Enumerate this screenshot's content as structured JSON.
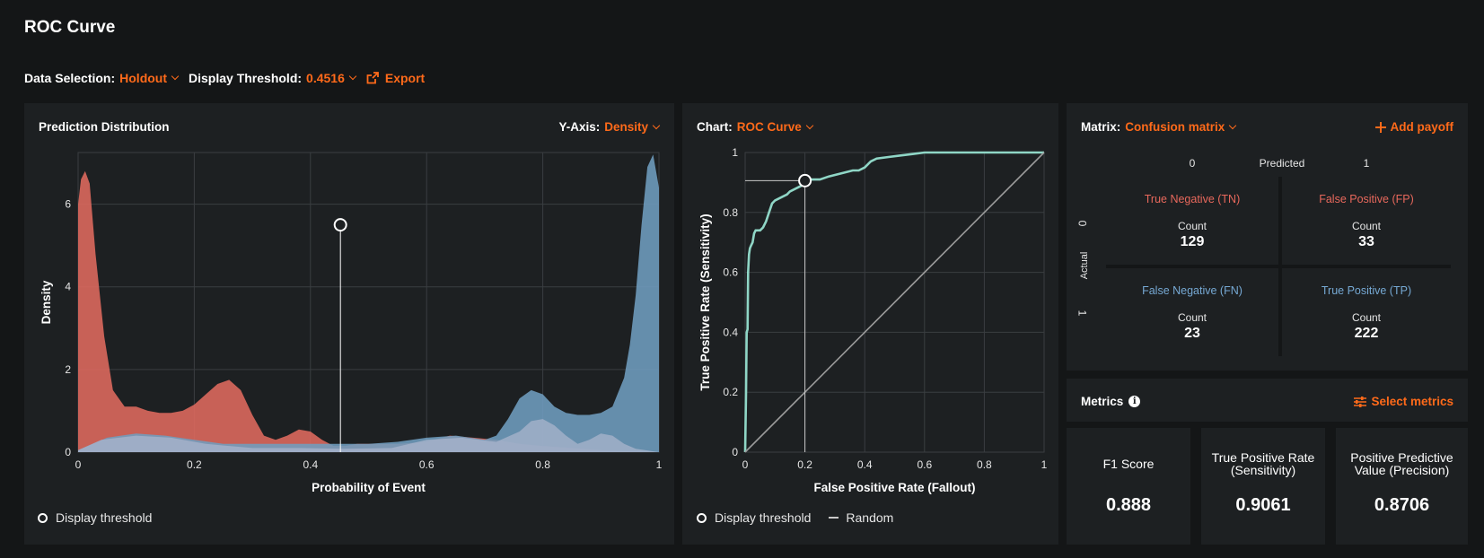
{
  "page_title": "ROC Curve",
  "toolbar": {
    "data_selection_label": "Data Selection:",
    "data_selection_value": "Holdout",
    "threshold_label": "Display Threshold:",
    "threshold_value": "0.4516",
    "export_label": "Export"
  },
  "distribution_panel": {
    "title": "Prediction Distribution",
    "yaxis_label": "Y-Axis:",
    "yaxis_value": "Density",
    "legend_threshold": "Display threshold"
  },
  "roc_panel": {
    "chart_label": "Chart:",
    "chart_value": "ROC Curve",
    "legend_threshold": "Display threshold",
    "legend_random": "Random"
  },
  "matrix_panel": {
    "matrix_label": "Matrix:",
    "matrix_value": "Confusion matrix",
    "add_payoff_label": "Add payoff",
    "predicted_label": "Predicted",
    "actual_label": "Actual",
    "col_0": "0",
    "col_1": "1",
    "row_0": "0",
    "row_1": "1",
    "count_label": "Count",
    "cells": {
      "tn": {
        "title": "True Negative (TN)",
        "count": "129"
      },
      "fp": {
        "title": "False Positive (FP)",
        "count": "33"
      },
      "fn": {
        "title": "False Negative (FN)",
        "count": "23"
      },
      "tp": {
        "title": "True Positive (TP)",
        "count": "222"
      }
    }
  },
  "metrics_panel": {
    "title": "Metrics",
    "select_label": "Select metrics",
    "metrics": [
      {
        "name": "F1 Score",
        "value": "0.888"
      },
      {
        "name": "True Positive Rate (Sensitivity)",
        "value": "0.9061"
      },
      {
        "name": "Positive Predictive Value (Precision)",
        "value": "0.8706"
      }
    ]
  },
  "colors": {
    "accent": "#ff6a1a",
    "negative_class": "#e06a5e",
    "positive_class": "#6f9dbf",
    "roc_line": "#8fd6c6",
    "panel_bg": "#1d2022",
    "page_bg": "#141617"
  },
  "chart_data": [
    {
      "type": "area",
      "xlabel": "Probability of Event",
      "ylabel": "Density",
      "xlim": [
        0,
        1
      ],
      "ylim": [
        0,
        7.25
      ],
      "xticks": [
        "0",
        "0.2",
        "0.4",
        "0.6",
        "0.8",
        "1"
      ],
      "yticks": [
        "0",
        "2",
        "4",
        "6"
      ],
      "threshold": {
        "x": 0.4516,
        "y": 5.5
      },
      "series": [
        {
          "color": "#e06a5e",
          "x": [
            0,
            0.005,
            0.012,
            0.02,
            0.03,
            0.045,
            0.06,
            0.08,
            0.1,
            0.12,
            0.14,
            0.16,
            0.18,
            0.2,
            0.22,
            0.24,
            0.26,
            0.28,
            0.3,
            0.32,
            0.34,
            0.36,
            0.38,
            0.4,
            0.42,
            0.44,
            0.46,
            0.48,
            0.5,
            0.55,
            0.6,
            0.64,
            0.68,
            0.72,
            0.76,
            0.8,
            0.85,
            0.9,
            0.95,
            1.0
          ],
          "y": [
            6.0,
            6.6,
            6.8,
            6.5,
            4.8,
            2.8,
            1.5,
            1.1,
            1.1,
            1.0,
            0.95,
            0.95,
            1.0,
            1.15,
            1.4,
            1.65,
            1.75,
            1.5,
            0.9,
            0.4,
            0.3,
            0.4,
            0.55,
            0.5,
            0.3,
            0.15,
            0.15,
            0.2,
            0.2,
            0.2,
            0.25,
            0.4,
            0.35,
            0.3,
            0.2,
            0.15,
            0.1,
            0.05,
            0.02,
            0
          ]
        },
        {
          "color": "#6f9dbf",
          "x": [
            0,
            0.05,
            0.1,
            0.15,
            0.2,
            0.25,
            0.3,
            0.35,
            0.4,
            0.45,
            0.5,
            0.55,
            0.6,
            0.65,
            0.7,
            0.72,
            0.74,
            0.76,
            0.78,
            0.8,
            0.82,
            0.84,
            0.86,
            0.88,
            0.9,
            0.92,
            0.94,
            0.95,
            0.96,
            0.97,
            0.98,
            0.99,
            1.0
          ],
          "y": [
            0.05,
            0.35,
            0.45,
            0.4,
            0.3,
            0.2,
            0.2,
            0.2,
            0.2,
            0.2,
            0.2,
            0.25,
            0.35,
            0.4,
            0.3,
            0.4,
            0.8,
            1.3,
            1.5,
            1.4,
            1.1,
            0.95,
            0.9,
            0.9,
            0.95,
            1.1,
            1.8,
            2.6,
            3.8,
            5.5,
            6.9,
            7.2,
            6.4
          ]
        },
        {
          "color": "#aab4cc",
          "x": [
            0,
            0.04,
            0.1,
            0.16,
            0.22,
            0.3,
            0.38,
            0.46,
            0.54,
            0.6,
            0.66,
            0.72,
            0.76,
            0.78,
            0.8,
            0.82,
            0.84,
            0.86,
            0.88,
            0.9,
            0.92,
            0.94,
            0.96,
            1.0
          ],
          "y": [
            0.05,
            0.3,
            0.4,
            0.35,
            0.2,
            0.1,
            0.1,
            0.08,
            0.1,
            0.3,
            0.35,
            0.25,
            0.5,
            0.75,
            0.8,
            0.65,
            0.4,
            0.2,
            0.3,
            0.45,
            0.4,
            0.2,
            0.08,
            0
          ]
        }
      ]
    },
    {
      "type": "line",
      "xlabel": "False Positive Rate (Fallout)",
      "ylabel": "True Positive Rate (Sensitivity)",
      "xlim": [
        0,
        1
      ],
      "ylim": [
        0,
        1
      ],
      "xticks": [
        "0",
        "0.2",
        "0.4",
        "0.6",
        "0.8",
        "1"
      ],
      "yticks": [
        "0",
        "0.2",
        "0.4",
        "0.6",
        "0.8",
        "1"
      ],
      "threshold": {
        "x": 0.2,
        "y": 0.9061
      },
      "series": [
        {
          "name": "ROC",
          "color": "#8fd6c6",
          "x": [
            0,
            0.003,
            0.005,
            0.008,
            0.01,
            0.013,
            0.016,
            0.02,
            0.025,
            0.03,
            0.035,
            0.05,
            0.06,
            0.07,
            0.08,
            0.09,
            0.1,
            0.12,
            0.14,
            0.15,
            0.17,
            0.19,
            0.2,
            0.22,
            0.25,
            0.28,
            0.32,
            0.36,
            0.38,
            0.4,
            0.42,
            0.44,
            0.48,
            0.52,
            0.56,
            0.6,
            0.62,
            1.0
          ],
          "y": [
            0,
            0.2,
            0.4,
            0.41,
            0.6,
            0.66,
            0.68,
            0.69,
            0.7,
            0.73,
            0.74,
            0.74,
            0.75,
            0.77,
            0.8,
            0.83,
            0.84,
            0.85,
            0.86,
            0.87,
            0.88,
            0.89,
            0.9,
            0.91,
            0.91,
            0.92,
            0.93,
            0.94,
            0.94,
            0.95,
            0.97,
            0.98,
            0.985,
            0.99,
            0.995,
            1.0,
            1.0,
            1.0
          ]
        },
        {
          "name": "Random",
          "color": "#9a9a9a",
          "x": [
            0,
            1
          ],
          "y": [
            0,
            1
          ]
        }
      ]
    }
  ]
}
